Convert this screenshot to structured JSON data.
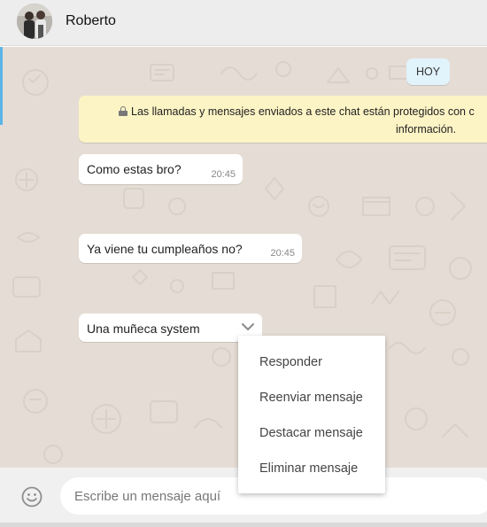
{
  "header": {
    "contact_name": "Roberto"
  },
  "chat": {
    "date_label": "HOY",
    "encryption_notice": {
      "line1": "Las llamadas y mensajes enviados a este chat están protegidos con c",
      "line2": "información."
    },
    "messages": [
      {
        "text": "Como estas bro?",
        "time": "20:45"
      },
      {
        "text": "Ya viene tu cumpleaños no?",
        "time": "20:45"
      },
      {
        "text": "Una muñeca system",
        "time": ""
      }
    ]
  },
  "context_menu": {
    "items": [
      {
        "label": "Responder"
      },
      {
        "label": "Reenviar mensaje"
      },
      {
        "label": "Destacar mensaje"
      },
      {
        "label": "Eliminar mensaje"
      }
    ]
  },
  "composer": {
    "placeholder": "Escribe un mensaje aquí",
    "value": ""
  },
  "colors": {
    "chat_background": "#e5ddd5",
    "notice_background": "#fdf4c5",
    "date_pill_background": "#e1f3fb",
    "header_background": "#ededed"
  },
  "icons": [
    "contact-avatar",
    "lock-icon",
    "chevron-down-icon",
    "emoji-icon"
  ]
}
